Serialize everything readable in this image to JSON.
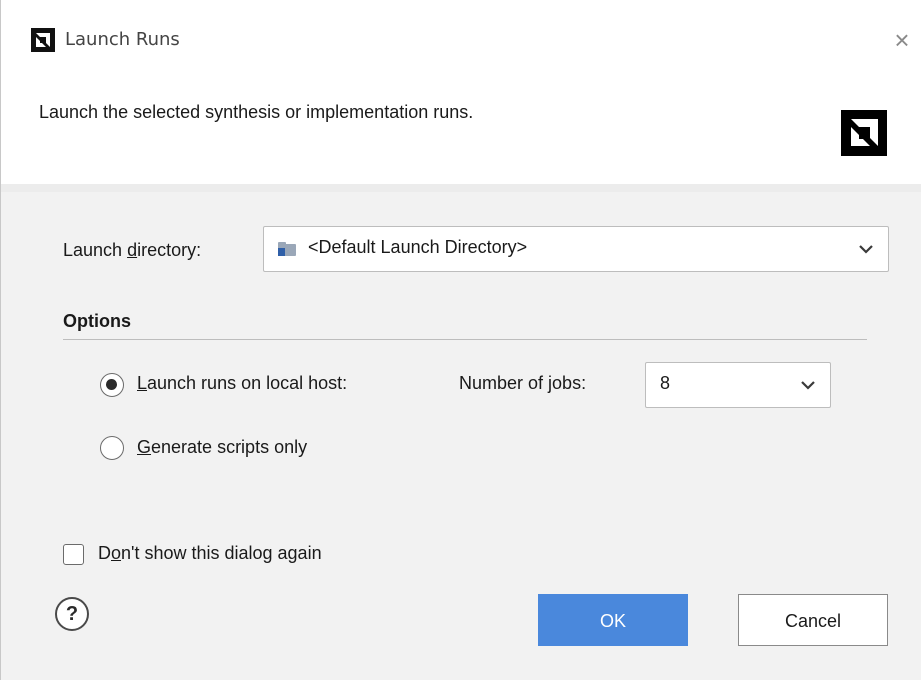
{
  "window": {
    "title": "Launch Runs",
    "close_glyph": "×",
    "app_icon": "amd-logo-icon"
  },
  "banner": {
    "description": "Launch the selected synthesis or implementation runs.",
    "logo_icon": "amd-logo-icon"
  },
  "launch_directory": {
    "label_pre": "Launch ",
    "label_mnemonic": "d",
    "label_post": "irectory:",
    "value": "<Default Launch Directory>",
    "icon": "folder-icon"
  },
  "options": {
    "heading": "Options",
    "local_host": {
      "mnemonic": "L",
      "label_rest": "aunch runs on local host:",
      "selected": true
    },
    "jobs": {
      "label_pre": "Number of ",
      "label_mnemonic": "j",
      "label_post": "obs:",
      "value": "8"
    },
    "scripts_only": {
      "mnemonic": "G",
      "label_rest": "enerate scripts only",
      "selected": false
    }
  },
  "dont_show": {
    "label_pre": "D",
    "label_mnemonic": "o",
    "label_post": "n't show this dialog again",
    "checked": false
  },
  "footer": {
    "help_glyph": "?",
    "ok_label": "OK",
    "cancel_label": "Cancel"
  },
  "colors": {
    "ok_button": "#4a88dc",
    "body_background": "#f2f2f2",
    "banner_background": "#ffffff"
  }
}
